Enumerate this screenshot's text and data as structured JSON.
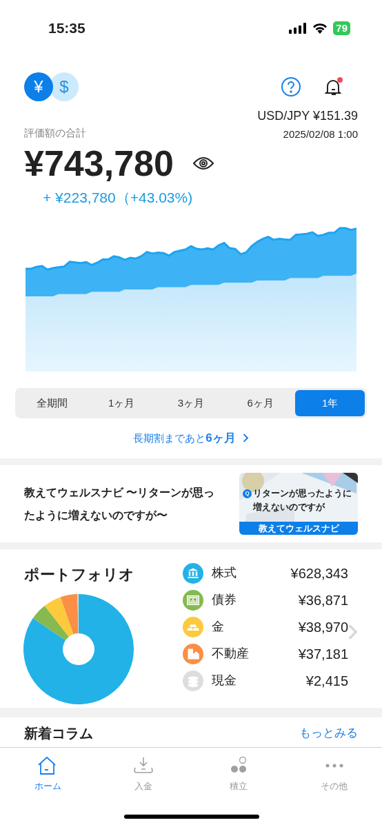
{
  "status_bar": {
    "time": "15:35",
    "battery": "79"
  },
  "header": {
    "currencies": [
      {
        "symbol": "¥",
        "selected": true
      },
      {
        "symbol": "$",
        "selected": false
      }
    ],
    "notification_unread": true
  },
  "rate": {
    "pair": "USD/JPY",
    "value": "¥151.39",
    "timestamp": "2025/02/08 1:00"
  },
  "total": {
    "label": "評価額の合計",
    "amount": "¥743,780",
    "change": "+ ¥223,780（+43.03%)"
  },
  "periods": [
    {
      "label": "全期間",
      "selected": false
    },
    {
      "label": "1ヶ月",
      "selected": false
    },
    {
      "label": "3ヶ月",
      "selected": false
    },
    {
      "label": "6ヶ月",
      "selected": false
    },
    {
      "label": "1年",
      "selected": true
    }
  ],
  "discount_link": {
    "prefix": "長期割まであと",
    "highlight": "6ヶ月"
  },
  "article": {
    "title": "教えてウェルスナビ 〜リターンが思ったように増えないのですが〜",
    "thumb_badge": "Q",
    "thumb_title": "リターンが思ったように増えないのですが",
    "thumb_footer": "教えてウェルスナビ"
  },
  "portfolio": {
    "title": "ポートフォリオ",
    "chart_data": {
      "type": "donut",
      "categories": [
        "株式",
        "債券",
        "金",
        "不動産",
        "現金"
      ],
      "series": [
        {
          "values": [
            84.48,
            4.96,
            5.24,
            5.0,
            0.32
          ]
        }
      ]
    },
    "assets": [
      {
        "amount": "¥628,343",
        "color": "#22b2e8",
        "kind": "stocks"
      },
      {
        "amount": "¥36,871",
        "color": "#86b94f",
        "kind": "bonds"
      },
      {
        "amount": "¥38,970",
        "color": "#fdc93d",
        "kind": "gold"
      },
      {
        "amount": "¥37,181",
        "color": "#fa8f45",
        "kind": "realestate"
      },
      {
        "amount": "¥2,415",
        "color": "#dddddd",
        "kind": "cash"
      }
    ]
  },
  "columns": {
    "title": "新着コラム",
    "more": "もっとみる"
  },
  "tab_bar": [
    {
      "label": "ホーム",
      "kind": "home",
      "selected": true
    },
    {
      "label": "入金",
      "kind": "deposit",
      "selected": false
    },
    {
      "label": "積立",
      "kind": "savings",
      "selected": false
    },
    {
      "label": "その他",
      "kind": "more",
      "selected": false
    }
  ]
}
